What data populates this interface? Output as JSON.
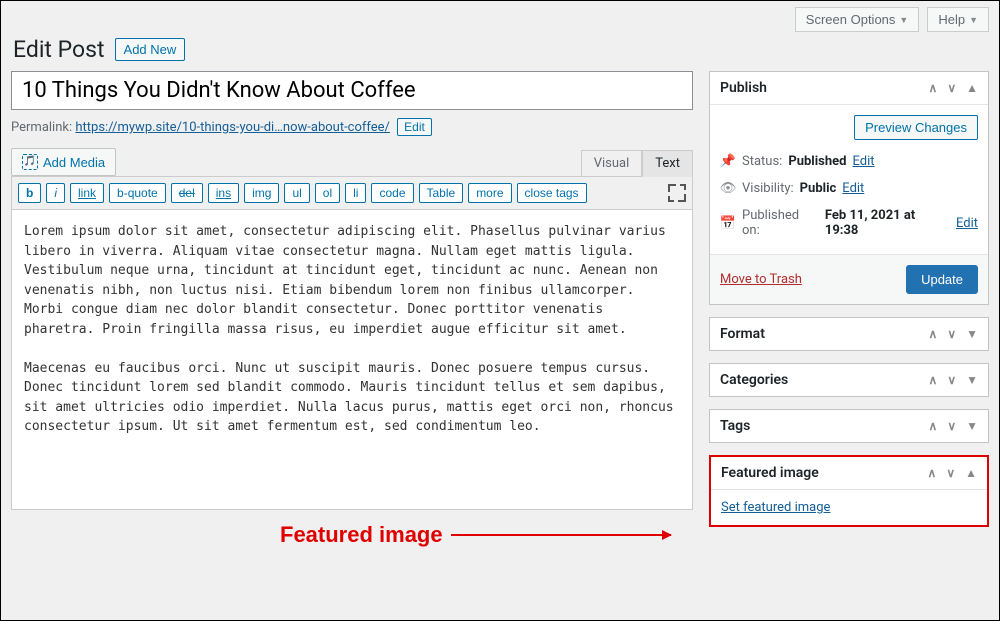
{
  "topbar": {
    "screen_options": "Screen Options",
    "help": "Help"
  },
  "header": {
    "title": "Edit Post",
    "add_new": "Add New"
  },
  "post": {
    "title": "10 Things You Didn't Know About Coffee",
    "permalink_label": "Permalink:",
    "permalink_url": "https://mywp.site/10-things-you-di…now-about-coffee/",
    "edit": "Edit"
  },
  "editor": {
    "add_media": "Add Media",
    "tabs": {
      "visual": "Visual",
      "text": "Text"
    },
    "quicktags": [
      "b",
      "i",
      "link",
      "b-quote",
      "del",
      "ins",
      "img",
      "ul",
      "ol",
      "li",
      "code",
      "Table",
      "more",
      "close tags"
    ],
    "content": "Lorem ipsum dolor sit amet, consectetur adipiscing elit. Phasellus pulvinar varius libero in viverra. Aliquam vitae consectetur magna. Nullam eget mattis ligula. Vestibulum neque urna, tincidunt at tincidunt eget, tincidunt ac nunc. Aenean non venenatis nibh, non luctus nisi. Etiam bibendum lorem non finibus ullamcorper. Morbi congue diam nec dolor blandit consectetur. Donec porttitor venenatis pharetra. Proin fringilla massa risus, eu imperdiet augue efficitur sit amet.\n\nMaecenas eu faucibus orci. Nunc ut suscipit mauris. Donec posuere tempus cursus. Donec tincidunt lorem sed blandit commodo. Mauris tincidunt tellus et sem dapibus, sit amet ultricies odio imperdiet. Nulla lacus purus, mattis eget orci non, rhoncus consectetur ipsum. Ut sit amet fermentum est, sed condimentum leo."
  },
  "publish": {
    "title": "Publish",
    "preview": "Preview Changes",
    "status_label": "Status:",
    "status_value": "Published",
    "visibility_label": "Visibility:",
    "visibility_value": "Public",
    "published_label": "Published on:",
    "published_value": "Feb 11, 2021 at 19:38",
    "edit": "Edit",
    "trash": "Move to Trash",
    "update": "Update"
  },
  "boxes": {
    "format": "Format",
    "categories": "Categories",
    "tags": "Tags",
    "featured": "Featured image",
    "set_featured": "Set featured image"
  },
  "annotation": "Featured image"
}
